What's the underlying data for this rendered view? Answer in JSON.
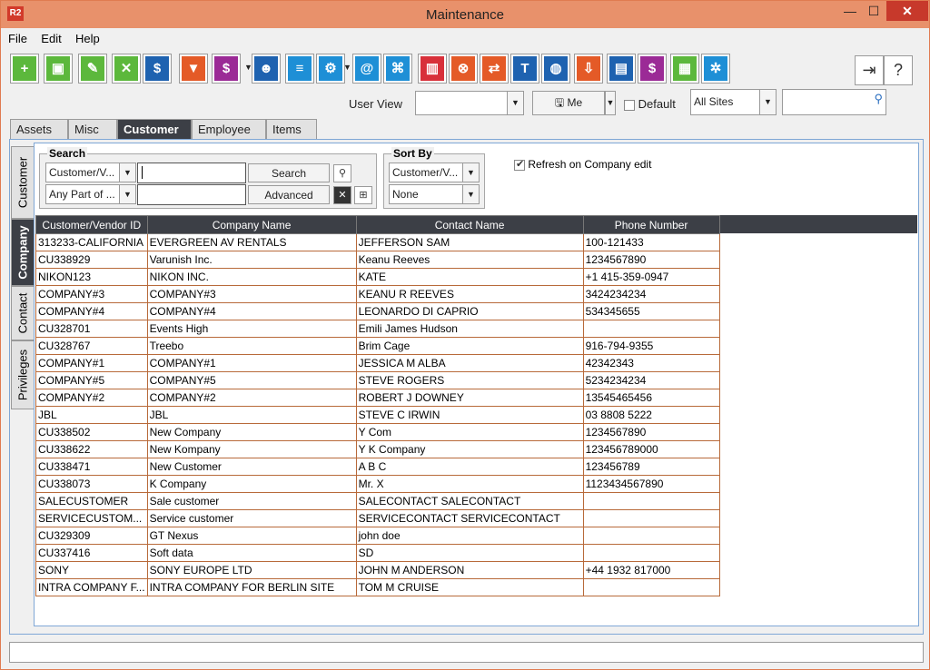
{
  "window": {
    "title": "Maintenance",
    "logo": "R2"
  },
  "menu": [
    "File",
    "Edit",
    "Help"
  ],
  "toolbar": [
    {
      "icon": "new-document-icon",
      "color": "#5cb83c",
      "glyph": "+"
    },
    {
      "icon": "save-icon",
      "color": "#5cb83c",
      "glyph": "▣"
    },
    {
      "icon": "edit-pencil-icon",
      "color": "#5cb83c",
      "glyph": "✎"
    },
    {
      "icon": "delete-x-icon",
      "color": "#5cb83c",
      "glyph": "✕"
    },
    {
      "icon": "truck-dollar-icon",
      "color": "#1e62b0",
      "glyph": "$"
    },
    {
      "icon": "filter-funnel-icon",
      "color": "#e45a27",
      "glyph": "▼"
    },
    {
      "icon": "dollar-list-icon",
      "color": "#9b2a96",
      "glyph": "$"
    },
    {
      "icon": "user-icon",
      "color": "#1e62b0",
      "glyph": "☻"
    },
    {
      "icon": "database-icon",
      "color": "#1e8fd6",
      "glyph": "≡"
    },
    {
      "icon": "document-gear-icon",
      "color": "#1e8fd6",
      "glyph": "⚙"
    },
    {
      "icon": "email-at-icon",
      "color": "#1e8fd6",
      "glyph": "@"
    },
    {
      "icon": "network-icon",
      "color": "#1e8fd6",
      "glyph": "⌘"
    },
    {
      "icon": "barcode-icon",
      "color": "#d8303a",
      "glyph": "▥"
    },
    {
      "icon": "cancel-box-icon",
      "color": "#e45a27",
      "glyph": "⊗"
    },
    {
      "icon": "transfer-icon",
      "color": "#e45a27",
      "glyph": "⇄"
    },
    {
      "icon": "tax-icon",
      "color": "#1e62b0",
      "glyph": "T"
    },
    {
      "icon": "globe-icon",
      "color": "#1e62b0",
      "glyph": "◍"
    },
    {
      "icon": "download-tray-icon",
      "color": "#e45a27",
      "glyph": "⇩"
    },
    {
      "icon": "id-card-icon",
      "color": "#1e62b0",
      "glyph": "▤"
    },
    {
      "icon": "dollar-icon",
      "color": "#9b2a96",
      "glyph": "$"
    },
    {
      "icon": "spreadsheet-icon",
      "color": "#5cb83c",
      "glyph": "▦"
    },
    {
      "icon": "user-network-icon",
      "color": "#1e8fd6",
      "glyph": "✲"
    }
  ],
  "toolbar_right": [
    {
      "icon": "exit-icon",
      "glyph": "⇥"
    },
    {
      "icon": "help-icon",
      "glyph": "?"
    }
  ],
  "view": {
    "user_view_label": "User View",
    "user_view_value": "",
    "me_label": "Me",
    "default_label": "Default",
    "sites_value": "All Sites",
    "search_value": ""
  },
  "tabs": [
    {
      "label": "Assets",
      "active": false
    },
    {
      "label": "Misc",
      "active": false
    },
    {
      "label": "Customer",
      "active": true
    },
    {
      "label": "Employee",
      "active": false
    },
    {
      "label": "Items",
      "active": false
    }
  ],
  "side_tabs": [
    {
      "label": "Customer",
      "active": false
    },
    {
      "label": "Company",
      "active": true
    },
    {
      "label": "Contact",
      "active": false
    },
    {
      "label": "Privileges",
      "active": false
    }
  ],
  "search": {
    "title": "Search",
    "field_value": "Customer/V...",
    "mode_value": "Any Part of ...",
    "search_text": "",
    "search_text2": "",
    "search_label": "Search",
    "advanced_label": "Advanced"
  },
  "sort": {
    "title": "Sort By",
    "field_value": "Customer/V...",
    "order_value": "None"
  },
  "refresh": {
    "label": "Refresh on Company edit",
    "checked": true
  },
  "table": {
    "columns": [
      "Customer/Vendor ID",
      "Company Name",
      "Contact Name",
      "Phone Number"
    ],
    "rows": [
      [
        "313233-CALIFORNIA",
        "EVERGREEN AV RENTALS",
        "JEFFERSON SAM",
        "100-121433"
      ],
      [
        "CU338929",
        "Varunish Inc.",
        "Keanu Reeves",
        "1234567890"
      ],
      [
        "NIKON123",
        "NIKON INC.",
        "KATE",
        "+1 415-359-0947"
      ],
      [
        "COMPANY#3",
        "COMPANY#3",
        "KEANU R REEVES",
        "3424234234"
      ],
      [
        "COMPANY#4",
        "COMPANY#4",
        "LEONARDO DI CAPRIO",
        "534345655"
      ],
      [
        "CU328701",
        "Events High",
        "Emili James Hudson",
        ""
      ],
      [
        "CU328767",
        "Treebo",
        "Brim Cage",
        "916-794-9355"
      ],
      [
        "COMPANY#1",
        "COMPANY#1",
        "JESSICA M ALBA",
        "42342343"
      ],
      [
        "COMPANY#5",
        "COMPANY#5",
        "STEVE ROGERS",
        "5234234234"
      ],
      [
        "COMPANY#2",
        "COMPANY#2",
        "ROBERT J DOWNEY",
        "13545465456"
      ],
      [
        "JBL",
        "JBL",
        "STEVE C IRWIN",
        "03 8808 5222"
      ],
      [
        "CU338502",
        "New Company",
        "Y Com",
        "1234567890"
      ],
      [
        "CU338622",
        "New Kompany",
        "Y K Company",
        "123456789000"
      ],
      [
        "CU338471",
        "New Customer",
        "A B C",
        "123456789"
      ],
      [
        "CU338073",
        "K Company",
        "Mr. X",
        "1123434567890"
      ],
      [
        "SALECUSTOMER",
        "Sale customer",
        "SALECONTACT SALECONTACT",
        ""
      ],
      [
        "SERVICECUSTOM...",
        "Service customer",
        "SERVICECONTACT SERVICECONTACT",
        ""
      ],
      [
        "CU329309",
        "GT Nexus",
        "john doe",
        ""
      ],
      [
        "CU337416",
        "Soft data",
        "SD",
        ""
      ],
      [
        "SONY",
        "SONY EUROPE LTD",
        "JOHN M ANDERSON",
        "+44 1932 817000"
      ],
      [
        "INTRA COMPANY F...",
        "INTRA COMPANY FOR BERLIN SITE",
        "TOM M CRUISE",
        ""
      ]
    ]
  },
  "status": {
    "text": ""
  }
}
